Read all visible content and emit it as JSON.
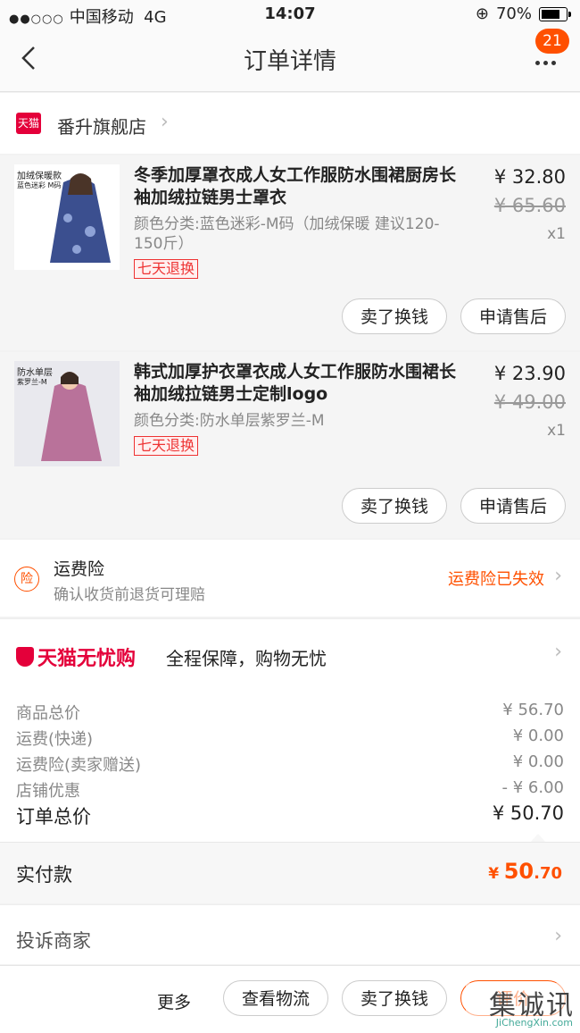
{
  "statusbar": {
    "carrier": "中国移动",
    "network": "4G",
    "time": "14:07",
    "battery": "70%"
  },
  "nav": {
    "title": "订单详情",
    "badge": "21"
  },
  "shop": {
    "logo_text": "天猫",
    "name": "番升旗舰店"
  },
  "items": [
    {
      "thumb_text_1": "加绒保暖款",
      "thumb_text_2": "蓝色迷彩 M码",
      "title": "冬季加厚罩衣成人女工作服防水围裙厨房长袖加绒拉链男士罩衣",
      "variant": "颜色分类:蓝色迷彩-M码（加绒保暖 建议120-150斤）",
      "tag": "七天退换",
      "price": "¥ 32.80",
      "orig_price": "¥ 65.60",
      "qty": "x1",
      "btn_sell": "卖了换钱",
      "btn_after": "申请售后",
      "thumb_color": "#3b4f8f"
    },
    {
      "thumb_text_1": "防水单层",
      "thumb_text_2": "紫罗兰-M",
      "title": "韩式加厚护衣罩衣成人女工作服防水围裙长袖加绒拉链男士定制logo",
      "variant": "颜色分类:防水单层紫罗兰-M",
      "tag": "七天退换",
      "price": "¥ 23.90",
      "orig_price": "¥ 49.00",
      "qty": "x1",
      "btn_sell": "卖了换钱",
      "btn_after": "申请售后",
      "thumb_color": "#b9729a"
    }
  ],
  "insurance": {
    "icon_text": "险",
    "title": "运费险",
    "subtitle": "确认收货前退货可理赔",
    "status": "运费险已失效"
  },
  "worry": {
    "logo": "天猫无忧购",
    "text": "全程保障，购物无忧"
  },
  "summary": {
    "rows": [
      {
        "label": "商品总价",
        "value": "¥ 56.70"
      },
      {
        "label": "运费(快递)",
        "value": "¥ 0.00"
      },
      {
        "label": "运费险(卖家赠送)",
        "value": "¥ 0.00"
      },
      {
        "label": "店铺优惠",
        "value": "- ¥ 6.00"
      }
    ],
    "total_label": "订单总价",
    "total_value": "¥ 50.70"
  },
  "paid": {
    "label": "实付款",
    "currency": "¥",
    "int": "50",
    "dec": ".70"
  },
  "complain": {
    "label": "投诉商家"
  },
  "bottom": {
    "more": "更多",
    "logistics": "查看物流",
    "sell": "卖了换钱",
    "rate": "评价"
  },
  "watermark": {
    "text": "集诚讯",
    "url": "JiChengXin.com"
  },
  "colors": {
    "accent": "#ff5000",
    "tmall_red": "#e4003a"
  }
}
